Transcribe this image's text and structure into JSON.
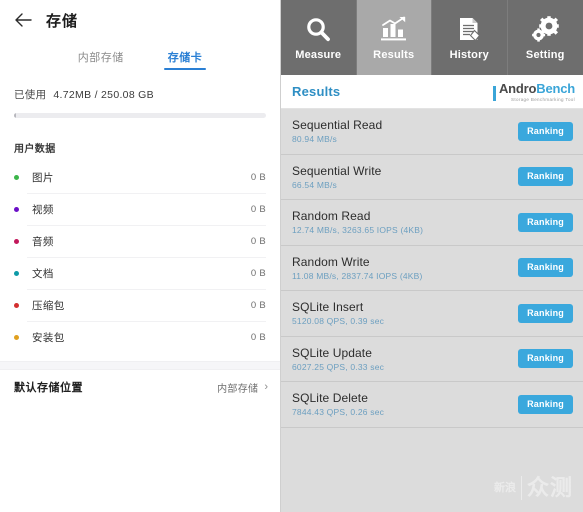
{
  "left_panel": {
    "appbar": {
      "back_icon": "back-arrow-icon",
      "title": "存储"
    },
    "tabs": [
      {
        "label": "内部存储",
        "active": false
      },
      {
        "label": "存储卡",
        "active": true
      }
    ],
    "usage": {
      "label": "已使用",
      "value": "4.72MB / 250.08 GB",
      "used_bytes_text": "4.72MB",
      "total_text": "250.08 GB",
      "percent": 0.0019
    },
    "section_title": "用户数据",
    "data_items": [
      {
        "label": "图片",
        "size": "0 B",
        "color": "#3cb54a"
      },
      {
        "label": "视频",
        "size": "0 B",
        "color": "#6b0fc7"
      },
      {
        "label": "音频",
        "size": "0 B",
        "color": "#c2185b"
      },
      {
        "label": "文档",
        "size": "0 B",
        "color": "#0e9aa7"
      },
      {
        "label": "压缩包",
        "size": "0 B",
        "color": "#d32f2f"
      },
      {
        "label": "安装包",
        "size": "0 B",
        "color": "#e0a020"
      }
    ],
    "default_location": {
      "label": "默认存储位置",
      "value": "内部存储",
      "chevron": "chevron-right-icon"
    }
  },
  "right_panel": {
    "nav_tabs": [
      {
        "label": "Measure",
        "icon": "magnifier-icon",
        "active": false
      },
      {
        "label": "Results",
        "icon": "bar-chart-icon",
        "active": true
      },
      {
        "label": "History",
        "icon": "document-icon",
        "active": false
      },
      {
        "label": "Setting",
        "icon": "gears-icon",
        "active": false
      }
    ],
    "results_title": "Results",
    "logo": {
      "name_part1": "Andro",
      "name_part2": "Bench",
      "tagline": "Storage Benchmarking Tool"
    },
    "ranking_label": "Ranking",
    "results": [
      {
        "name": "Sequential Read",
        "value": "80.94 MB/s"
      },
      {
        "name": "Sequential Write",
        "value": "66.54 MB/s"
      },
      {
        "name": "Random Read",
        "value": "12.74 MB/s, 3263.65 IOPS (4KB)"
      },
      {
        "name": "Random Write",
        "value": "11.08 MB/s, 2837.74 IOPS (4KB)"
      },
      {
        "name": "SQLite Insert",
        "value": "5120.08 QPS, 0.39 sec"
      },
      {
        "name": "SQLite Update",
        "value": "6027.25 QPS, 0.33 sec"
      },
      {
        "name": "SQLite Delete",
        "value": "7844.43 QPS, 0.26 sec"
      }
    ],
    "watermark": {
      "small": "新浪",
      "big": "众测"
    }
  },
  "colors": {
    "accent_blue": "#3aa8dd",
    "tab_active_blue": "#2a7fd4",
    "nav_inactive": "#6e6e6e",
    "nav_active": "#a9a9a9",
    "panel_bg": "#dcdcdc"
  }
}
